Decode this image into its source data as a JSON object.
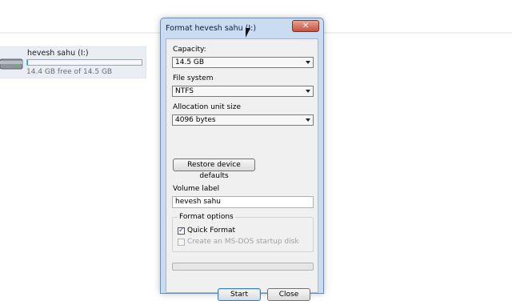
{
  "explorer": {
    "drive_name": "hevesh sahu (I:)",
    "drive_free_text": "14.4 GB free of 14.5 GB",
    "drive_used_fraction": 0.01
  },
  "dialog": {
    "title": "Format hevesh sahu (I:)",
    "close_label": "✕",
    "capacity_label": "Capacity:",
    "capacity_value": "14.5 GB",
    "filesystem_label": "File system",
    "filesystem_value": "NTFS",
    "allocation_label": "Allocation unit size",
    "allocation_value": "4096 bytes",
    "restore_label": "Restore device defaults",
    "volume_label_label": "Volume label",
    "volume_label_value": "hevesh sahu",
    "format_options_label": "Format options",
    "quick_format_label": "Quick Format",
    "quick_format_checked": true,
    "msdos_label": "Create an MS-DOS startup disk",
    "msdos_checked": false,
    "progress_fraction": 0,
    "start_label": "Start",
    "close_button_label": "Close"
  },
  "colors": {
    "accent": "#26a0da",
    "dialog_frame": "#c9dcf2",
    "close_button": "#c7523b"
  }
}
